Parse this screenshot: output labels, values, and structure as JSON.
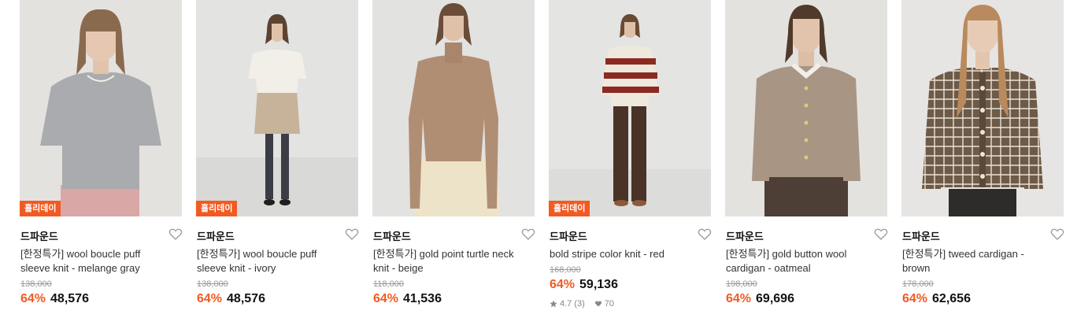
{
  "products": [
    {
      "badge": "홀리데이",
      "brand": "드파운드",
      "name_line1": "[한정특가] wool boucle puff",
      "name_line2": "sleeve knit - melange gray",
      "original_price": "138,000",
      "discount": "64%",
      "price": "48,576"
    },
    {
      "badge": "홀리데이",
      "brand": "드파운드",
      "name_line1": "[한정특가] wool boucle puff",
      "name_line2": "sleeve knit - ivory",
      "original_price": "138,000",
      "discount": "64%",
      "price": "48,576"
    },
    {
      "brand": "드파운드",
      "name_line1": "[한정특가] gold point turtle neck",
      "name_line2": "knit - beige",
      "original_price": "118,000",
      "discount": "64%",
      "price": "41,536"
    },
    {
      "badge": "홀리데이",
      "brand": "드파운드",
      "name_line1": "bold stripe color knit - red",
      "name_line2": "",
      "original_price": "168,000",
      "discount": "64%",
      "price": "59,136",
      "rating": "4.7",
      "review_count": "(3)",
      "likes": "70"
    },
    {
      "brand": "드파운드",
      "name_line1": "[한정특가] gold button wool",
      "name_line2": "cardigan - oatmeal",
      "original_price": "198,000",
      "discount": "64%",
      "price": "69,696"
    },
    {
      "brand": "드파운드",
      "name_line1": "[한정특가] tweed cardigan -",
      "name_line2": "brown",
      "original_price": "178,000",
      "discount": "64%",
      "price": "62,656"
    }
  ],
  "colors": {
    "accent": "#f15a22",
    "text": "#111111",
    "muted": "#999999"
  },
  "icons": {
    "wishlist": "heart-outline-icon",
    "rating": "star-icon",
    "likes": "heart-filled-icon"
  }
}
